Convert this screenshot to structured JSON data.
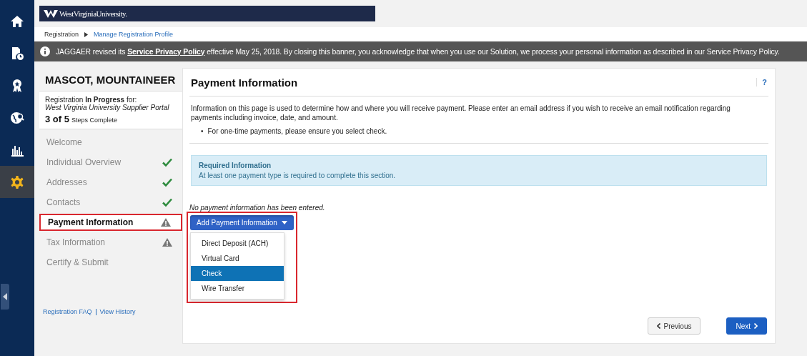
{
  "rail": {
    "items": [
      {
        "kind": "home",
        "selected": false
      },
      {
        "kind": "document",
        "selected": false
      },
      {
        "kind": "award",
        "selected": false
      },
      {
        "kind": "globe",
        "selected": false
      },
      {
        "kind": "chart",
        "selected": false
      },
      {
        "kind": "gear",
        "selected": true
      }
    ]
  },
  "logo": {
    "text": "WestVirginiaUniversity."
  },
  "breadcrumb": [
    {
      "label": "Registration",
      "link": false
    },
    {
      "label": "Manage Registration Profile",
      "link": true
    }
  ],
  "banner": {
    "before": "JAGGAER revised its ",
    "link": "Service Privacy Policy",
    "after": " effective May 25, 2018. By closing this banner, you acknowledge that when you use our Solution, we process your personal information as described in our Service Privacy Policy."
  },
  "sidebar": {
    "name": "MASCOT, MOUNTAINEER",
    "status": "Registration **In Progress** for:",
    "portal": "West Virginia University Supplier Portal",
    "steps_count": "3 of 5",
    "steps_label": "Steps Complete",
    "steps": [
      {
        "label": "Welcome",
        "kind": "plain",
        "selected": false
      },
      {
        "label": "Individual Overview",
        "kind": "complete",
        "selected": false
      },
      {
        "label": "Addresses",
        "kind": "complete",
        "selected": false
      },
      {
        "label": "Contacts",
        "kind": "complete",
        "selected": false
      },
      {
        "label": "Payment Information",
        "kind": "warning",
        "selected": true
      },
      {
        "label": "Tax Information",
        "kind": "warning",
        "selected": false
      },
      {
        "label": "Certify & Submit",
        "kind": "plain",
        "selected": false
      }
    ],
    "links": [
      "Registration FAQ",
      "View History"
    ]
  },
  "panel": {
    "title": "Payment Information",
    "help": "?",
    "intro": "Information on this page is used to determine how and where you will receive payment. Please enter an email address if you wish to receive an email notification regarding payments including invoice, date, and amount.",
    "bullets": [
      {
        "marker": "•",
        "text": "For one-time payments, please ensure you select check."
      }
    ],
    "alert": {
      "title": "Required Information",
      "text": "At least one payment type is required to complete this section."
    },
    "empty": "No payment information has been entered.",
    "dropdown": {
      "label": "Add Payment Information",
      "expanded": true,
      "highlighted": true,
      "options": [
        {
          "label": "Direct Deposit (ACH)",
          "selected": false
        },
        {
          "label": "Virtual Card",
          "selected": false
        },
        {
          "label": "Check",
          "selected": true
        },
        {
          "label": "Wire Transfer",
          "selected": false
        }
      ]
    },
    "buttons": [
      {
        "label": "Previous",
        "kind": "previous"
      },
      {
        "label": "Next",
        "kind": "next"
      }
    ]
  }
}
